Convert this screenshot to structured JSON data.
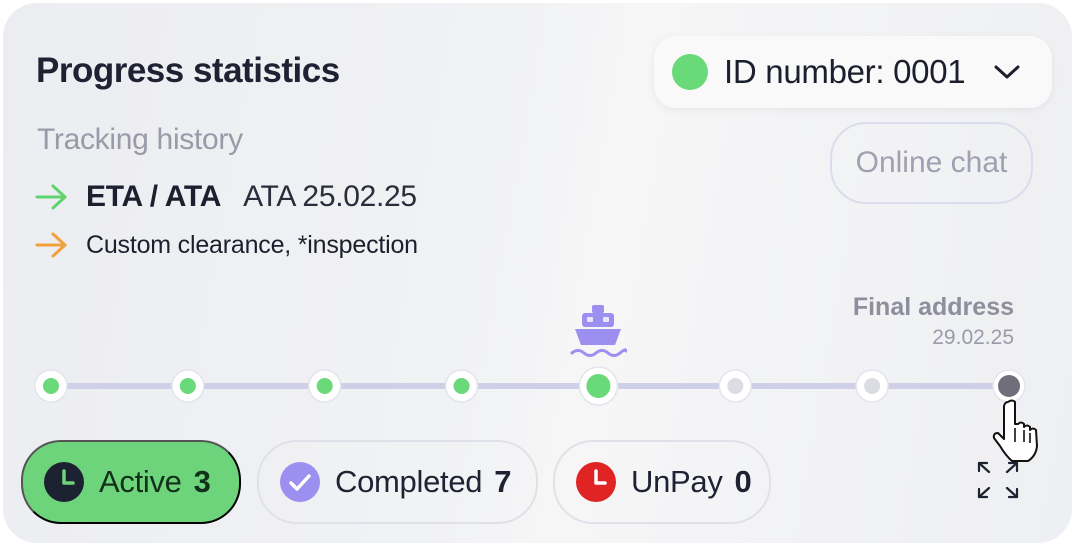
{
  "header": {
    "title": "Progress statistics",
    "id_selector": {
      "label": "ID number: 0001",
      "dot_color": "#6ad97a",
      "icon": "chevron-down-icon"
    }
  },
  "tracking": {
    "subtitle": "Tracking history",
    "online_chat_label": "Online chat",
    "events": [
      {
        "icon": "arrow-right-icon",
        "color": "#5fd46e",
        "label": "ETA / ATA",
        "value": "ATA 25.02.25"
      },
      {
        "icon": "arrow-right-icon",
        "color": "#f0a23a",
        "label": "Custom clearance, *inspection"
      }
    ]
  },
  "progress": {
    "final_label": "Final address",
    "final_date": "29.02.25",
    "total_steps": 8,
    "completed_steps": 5,
    "current_step": 5,
    "current_icon": "ship-icon",
    "accent_color": "#6ad97a",
    "pending_color": "#cfcfe8",
    "final_color": "#6e6f7a"
  },
  "statuses": [
    {
      "icon": "clock-icon",
      "label": "Active",
      "count": "3",
      "color": "#6ed47b"
    },
    {
      "icon": "check-circle-icon",
      "label": "Completed",
      "count": "7",
      "color": "#9d8ff0"
    },
    {
      "icon": "clock-icon",
      "label": "UnPay",
      "count": "0",
      "color": "#e02424"
    }
  ],
  "controls": {
    "expand_icon": "expand-icon",
    "cursor_icon": "pointer-cursor-icon"
  }
}
